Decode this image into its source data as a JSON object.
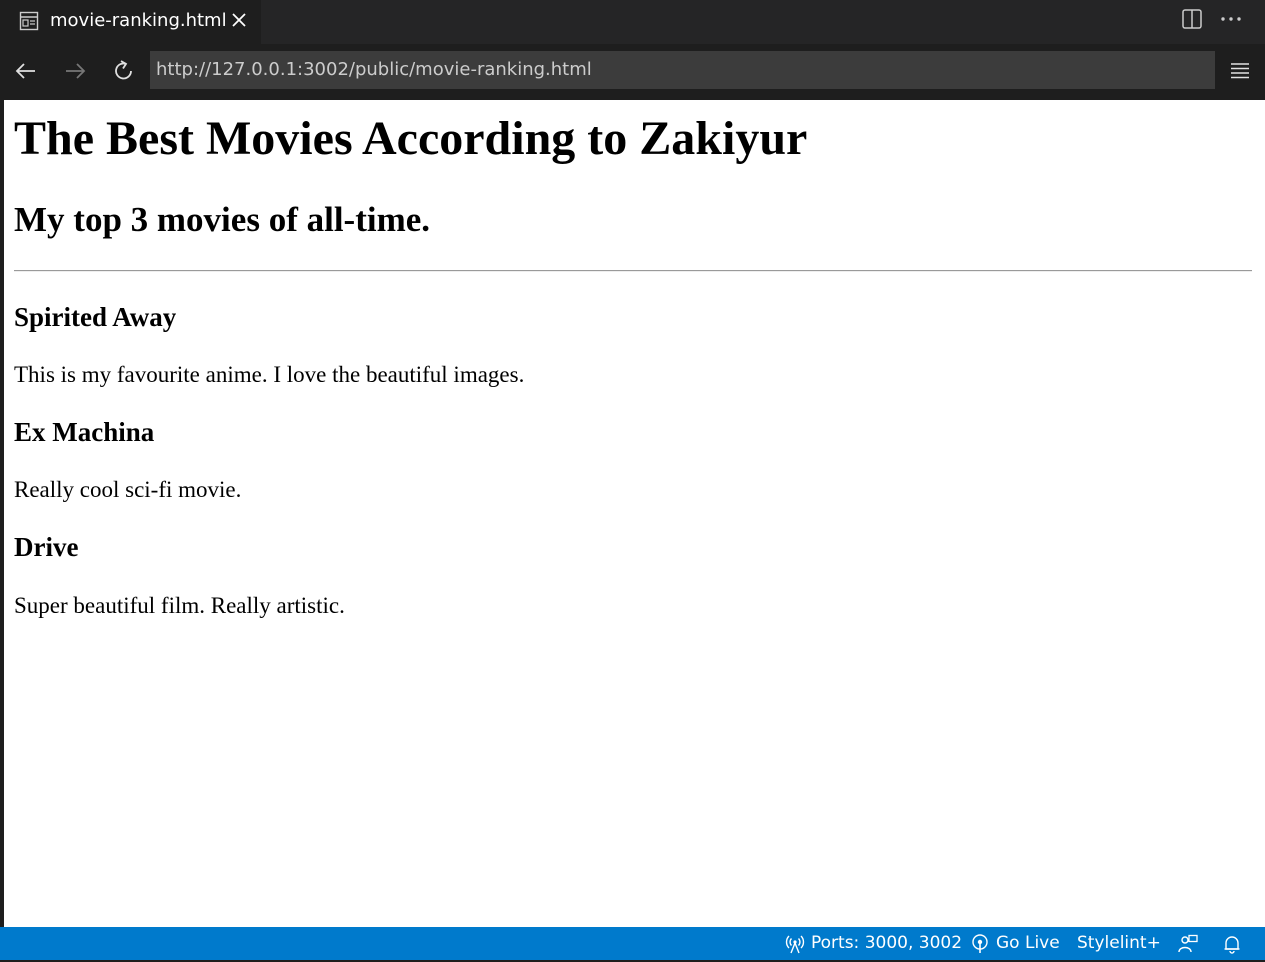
{
  "tab": {
    "title": "movie-ranking.html",
    "icon": "preview-icon"
  },
  "nav": {
    "url": "http://127.0.0.1:3002/public/movie-ranking.html"
  },
  "page": {
    "heading": "The Best Movies According to Zakiyur",
    "subheading": "My top 3 movies of all-time.",
    "movies": [
      {
        "title": "Spirited Away",
        "description": "This is my favourite anime. I love the beautiful images."
      },
      {
        "title": "Ex Machina",
        "description": "Really cool sci-fi movie."
      },
      {
        "title": "Drive",
        "description": "Super beautiful film. Really artistic."
      }
    ]
  },
  "status": {
    "ports": "Ports: 3000, 3002",
    "go_live": "Go Live",
    "stylelint": "Stylelint+"
  },
  "colors": {
    "statusbar": "#007acc",
    "editor_bg": "#1e1e1e",
    "url_bg": "#3c3c3c"
  }
}
